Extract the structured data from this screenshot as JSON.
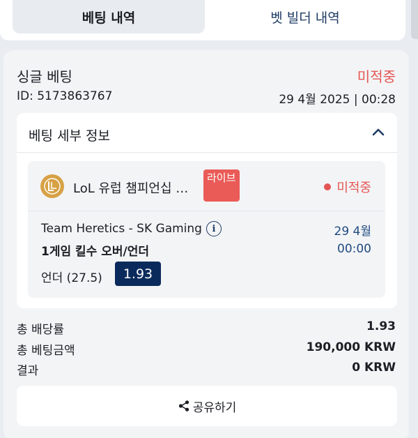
{
  "tabs": [
    {
      "label": "베팅 내역",
      "active": true
    },
    {
      "label": "벳 빌더 내역",
      "active": false
    }
  ],
  "bet": {
    "title": "싱글 베팅",
    "status": "미적중",
    "id": "ID: 5173863767",
    "datetime": "29 4월 2025 | 00:28"
  },
  "details": {
    "title": "베팅 세부 정보",
    "league": "LoL 유럽 챔피언십 …",
    "live_badge": "라이브",
    "selection_status": "미적중",
    "match": "Team Heretics - SK Gaming",
    "match_date": "29 4월",
    "market": "1게임 킬수 오버/언더",
    "match_time": "00:00",
    "pick": "언더 (27.5)",
    "odds": "1.93"
  },
  "summary": [
    {
      "label": "총 배당률",
      "value": "1.93"
    },
    {
      "label": "총 베팅금액",
      "value": "190,000 KRW"
    },
    {
      "label": "결과",
      "value": "0 KRW"
    }
  ],
  "share_label": "공유하기",
  "colors": {
    "lost": "#e45653",
    "navy": "#0b2a5c",
    "league_gold": "#d7a145",
    "live_red": "#ea5b57"
  },
  "icons": [
    "chevron-up-icon",
    "league-icon",
    "info-icon",
    "share-icon"
  ]
}
